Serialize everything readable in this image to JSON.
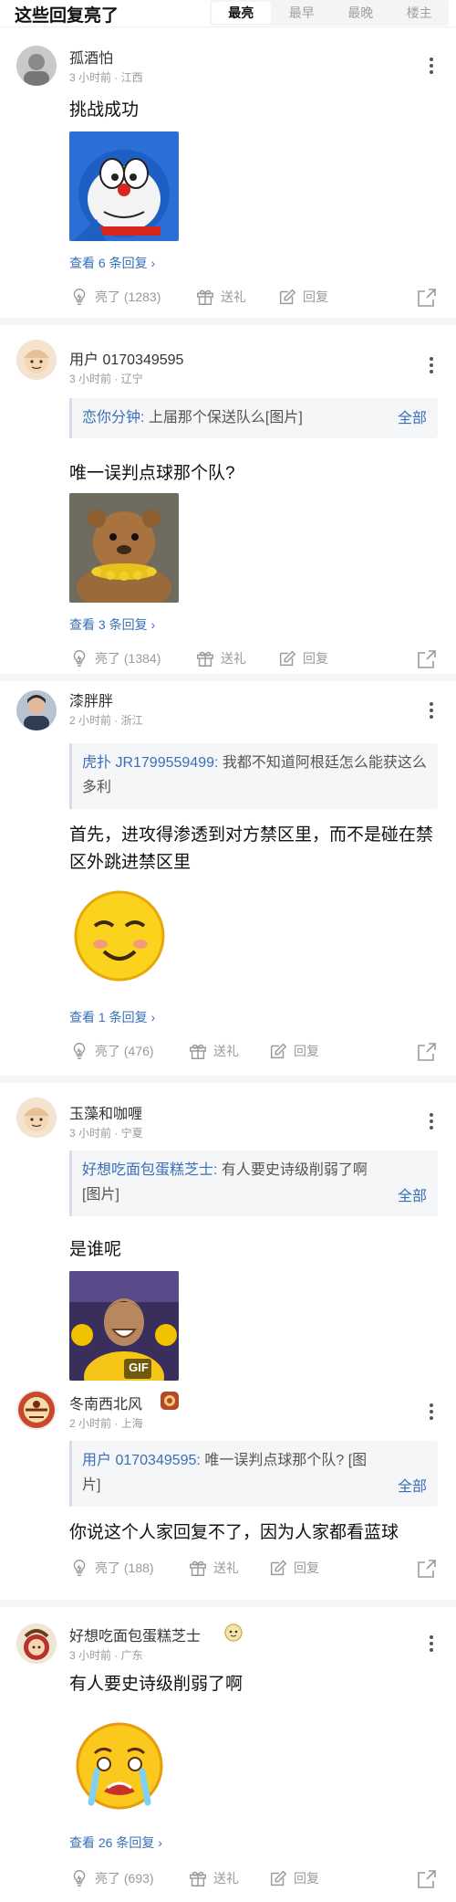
{
  "header": {
    "title": "这些回复亮了",
    "tabs": [
      "最亮",
      "最早",
      "最晚",
      "楼主"
    ]
  },
  "comments": [
    {
      "username": "孤酒怕",
      "meta": "3 小时前 · 江西",
      "text": "挑战成功",
      "view_replies": "查看 6 条回复 ›",
      "like": "亮了 (1283)",
      "gift": "送礼",
      "reply": "回复"
    },
    {
      "username": "用户 0170349595",
      "meta": "3 小时前 · 辽宁",
      "quote_name": "恋你分钟:",
      "quote_text": "上届那个保送队么[图片]",
      "quote_all": "全部",
      "text": "唯一误判点球那个队?",
      "view_replies": "查看 3 条回复 ›",
      "like": "亮了 (1384)",
      "gift": "送礼",
      "reply": "回复"
    },
    {
      "username": "漆胖胖",
      "meta": "2 小时前 · 浙江",
      "quote_name": "虎扑 JR1799559499:",
      "quote_text": "我都不知道阿根廷怎么能获这么多利",
      "text": "首先，进攻得渗透到对方禁区里，而不是碰在禁区外跳进禁区里",
      "view_replies": "查看 1 条回复 ›",
      "like": "亮了 (476)",
      "gift": "送礼",
      "reply": "回复"
    },
    {
      "username": "玉藻和咖喱",
      "meta": "3 小时前 · 宁夏",
      "quote_name": "好想吃面包蛋糕芝士:",
      "quote_text": "有人要史诗级削弱了啊[图片]",
      "quote_all": "全部",
      "text": "是谁呢",
      "gif_label": "GIF"
    },
    {
      "username": "冬南西北风",
      "meta": "2 小时前 · 上海",
      "quote_name": "用户 0170349595:",
      "quote_text": "唯一误判点球那个队? [图片]",
      "quote_all": "全部",
      "text": "你说这个人家回复不了，因为人家都看蓝球",
      "like": "亮了 (188)",
      "gift": "送礼",
      "reply": "回复"
    },
    {
      "username": "好想吃面包蛋糕芝士",
      "meta": "3 小时前 · 广东",
      "text": "有人要史诗级削弱了啊",
      "view_replies": "查看 26 条回复 ›",
      "like": "亮了 (693)",
      "gift": "送礼",
      "reply": "回复"
    }
  ],
  "colors": {
    "link": "#3a6fb7",
    "meta": "#9a9a9a",
    "quote_bg": "#f5f6f8",
    "separator": "#f5f5f5"
  },
  "icons": [
    "lightbulb-icon",
    "gift-icon",
    "edit-icon",
    "share-icon",
    "more-icon"
  ]
}
